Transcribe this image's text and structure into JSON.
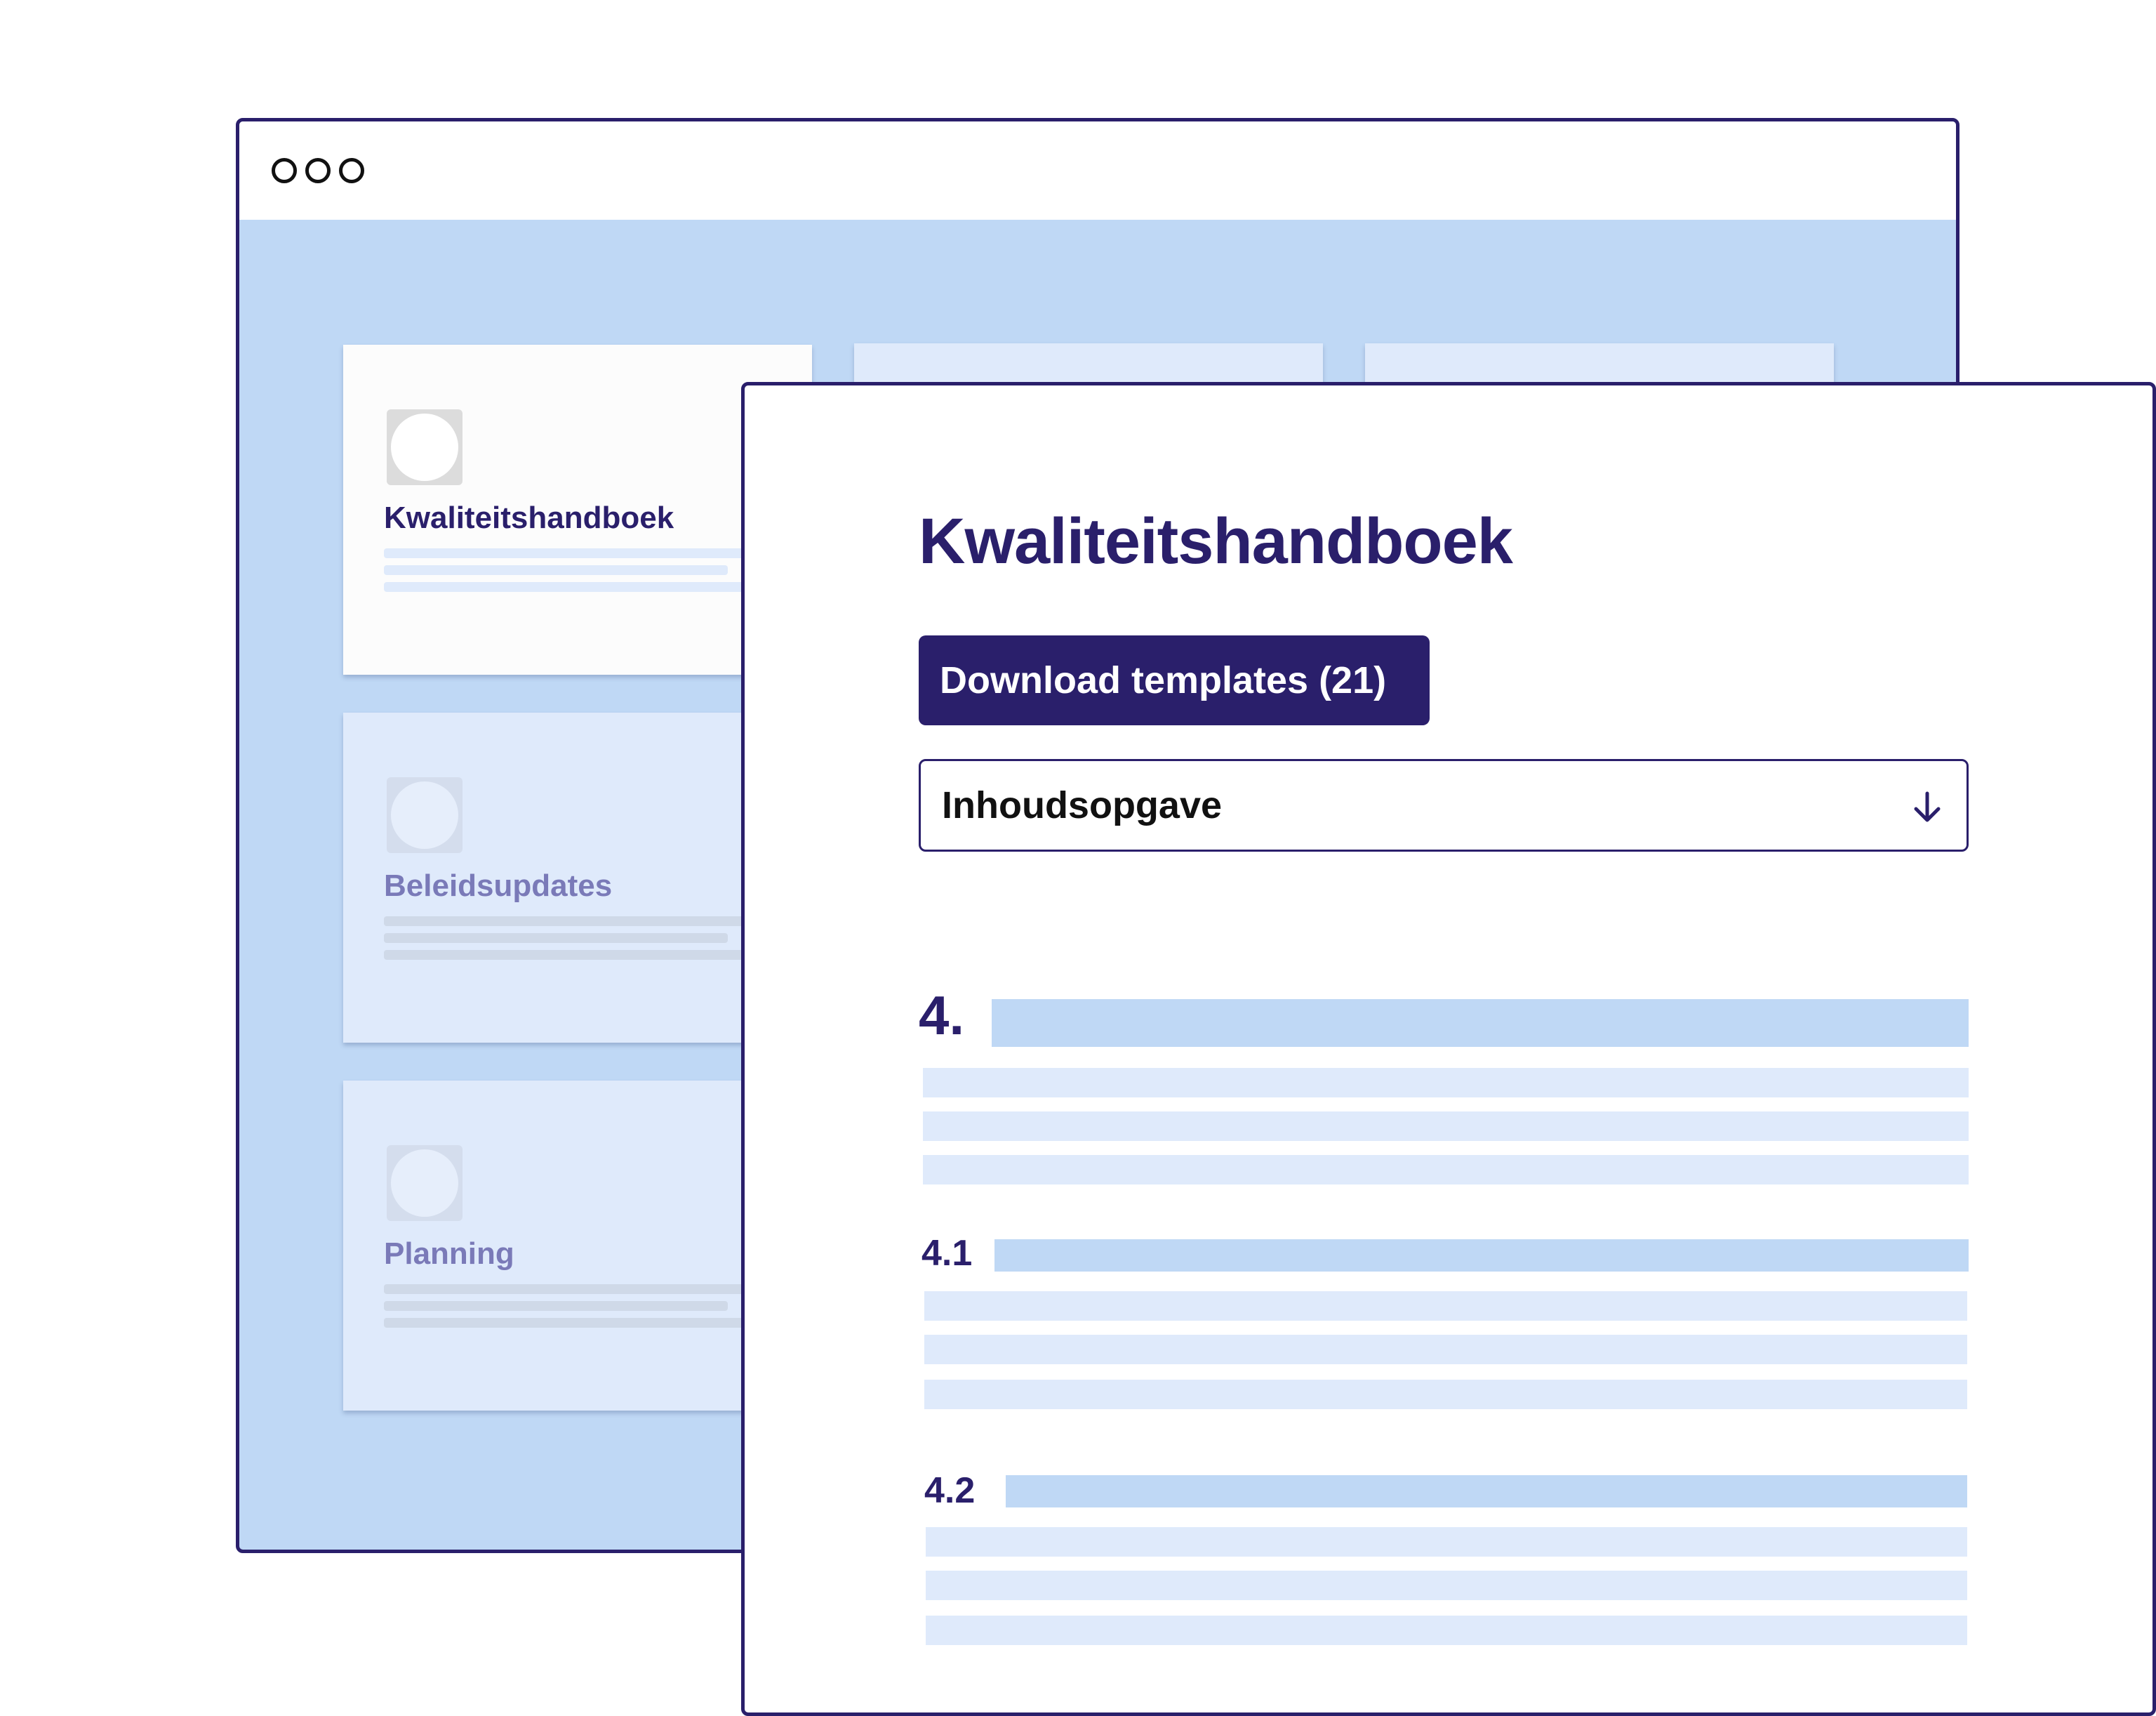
{
  "cards": [
    {
      "label": "Kwaliteitshandboek"
    },
    {
      "label": "Beleidsupdates"
    },
    {
      "label": "Planning"
    }
  ],
  "document": {
    "title": "Kwaliteitshandboek",
    "download_button": "Download templates (21)",
    "toc_select": {
      "value": "Inhoudsopgave",
      "icon": "arrow-down-icon"
    },
    "sections": [
      {
        "number": "4."
      },
      {
        "number": "4.1"
      },
      {
        "number": "4.2"
      }
    ]
  },
  "colors": {
    "primary": "#2a1f6b",
    "app_background": "#bfd8f5",
    "card_inactive": "#dfeafb"
  }
}
